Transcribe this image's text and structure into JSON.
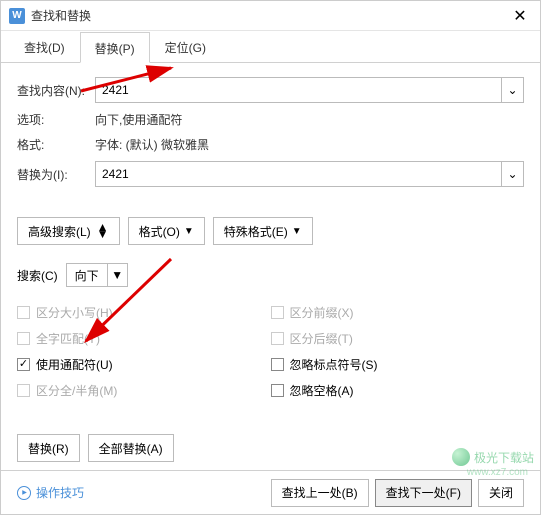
{
  "window": {
    "title": "查找和替换"
  },
  "tabs": {
    "find": "查找(D)",
    "replace": "替换(P)",
    "goto": "定位(G)"
  },
  "labels": {
    "find_content": "查找内容(N):",
    "options": "选项:",
    "format": "格式:",
    "replace_with": "替换为(I):",
    "search": "搜索(C)"
  },
  "values": {
    "find_content": "2421",
    "options_text": "向下,使用通配符",
    "format_text": "字体: (默认) 微软雅黑",
    "replace_with": "2421",
    "search_direction": "向下"
  },
  "buttons": {
    "advanced": "高级搜索(L)",
    "format_btn": "格式(O)",
    "special": "特殊格式(E)",
    "replace": "替换(R)",
    "replace_all": "全部替换(A)",
    "tips": "操作技巧",
    "find_prev": "查找上一处(B)",
    "find_next": "查找下一处(F)",
    "close": "关闭"
  },
  "checks": {
    "case": "区分大小写(H)",
    "whole": "全字匹配(Y)",
    "wildcard": "使用通配符(U)",
    "width": "区分全/半角(M)",
    "prefix": "区分前缀(X)",
    "suffix": "区分后缀(T)",
    "punct": "忽略标点符号(S)",
    "space": "忽略空格(A)"
  },
  "watermark": {
    "name": "极光下载站",
    "url": "www.xz7.com"
  }
}
